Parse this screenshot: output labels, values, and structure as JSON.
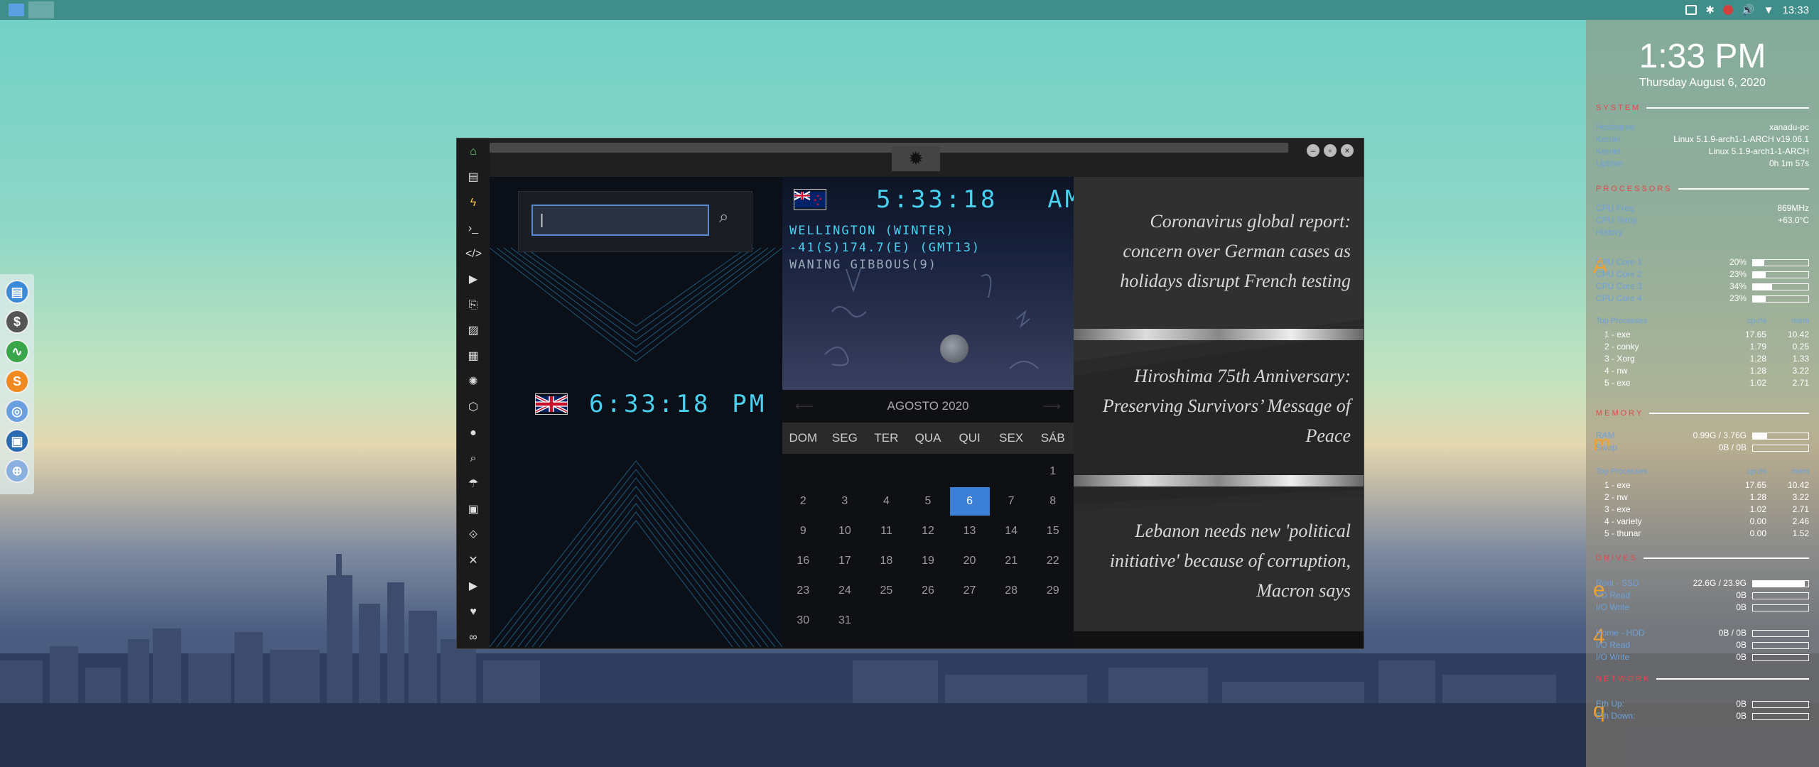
{
  "topbar": {
    "time": "13:33"
  },
  "window": {
    "search": {
      "value": "|"
    },
    "uk_clock": {
      "time": "6:33:18",
      "ampm": "PM"
    },
    "nz_clock": {
      "time": "5:33:18",
      "ampm": "AM"
    },
    "nz_info": {
      "line1": "WELLINGTON (WINTER)",
      "line2": "-41(S)174.7(E) (GMT13)",
      "line3": "WANING GIBBOUS(9)"
    },
    "calendar": {
      "month": "AGOSTO 2020",
      "dows": [
        "DOM",
        "SEG",
        "TER",
        "QUA",
        "QUI",
        "SEX",
        "SÁB"
      ],
      "days": [
        "",
        "",
        "",
        "",
        "",
        "",
        "1",
        "2",
        "3",
        "4",
        "5",
        "6",
        "7",
        "8",
        "9",
        "10",
        "11",
        "12",
        "13",
        "14",
        "15",
        "16",
        "17",
        "18",
        "19",
        "20",
        "21",
        "22",
        "23",
        "24",
        "25",
        "26",
        "27",
        "28",
        "29",
        "30",
        "31",
        "",
        "",
        "",
        "",
        ""
      ],
      "today": "6"
    },
    "news": [
      "Coronavirus global report: concern over German cases as holidays disrupt French testing",
      "Hiroshima 75th Anniversary: Preserving Survivors’ Message of Peace",
      "Lebanon needs new 'political initiative' because of corruption, Macron says"
    ]
  },
  "conky": {
    "clock": "1:33 PM",
    "date": "Thursday August  6, 2020",
    "system": {
      "title": "SYSTEM",
      "rows": [
        {
          "k": "Hostname",
          "v": "xanadu-pc"
        },
        {
          "k": "Kernel",
          "v": "Linux 5.1.9-arch1-1-ARCH v19.06.1"
        },
        {
          "k": "Kernel",
          "v": "Linux 5.1.9-arch1-1-ARCH"
        },
        {
          "k": "Uptime",
          "v": "0h 1m 57s"
        }
      ]
    },
    "processors": {
      "title": "PROCESSORS",
      "rows": [
        {
          "k": "CPU Freq",
          "v": "869MHz"
        },
        {
          "k": "CPU Temp",
          "v": "+63.0°C"
        },
        {
          "k": "History",
          "v": ""
        }
      ],
      "letter": "A",
      "cores": [
        {
          "k": "CPU Core 1",
          "v": "20%",
          "p": 0.2
        },
        {
          "k": "CPU Core 2",
          "v": "23%",
          "p": 0.23
        },
        {
          "k": "CPU Core 3",
          "v": "34%",
          "p": 0.34
        },
        {
          "k": "CPU Core 4",
          "v": "23%",
          "p": 0.23
        }
      ],
      "top_header": {
        "n": "Top Processes",
        "c1": "cpu%",
        "c2": "mem"
      },
      "top": [
        {
          "n": "1  -  exe",
          "c1": "17.65",
          "c2": "10.42"
        },
        {
          "n": "2  -  conky",
          "c1": "1.79",
          "c2": "0.25"
        },
        {
          "n": "3  -  Xorg",
          "c1": "1.28",
          "c2": "1.33"
        },
        {
          "n": "4  -  nw",
          "c1": "1.28",
          "c2": "3.22"
        },
        {
          "n": "5  -  exe",
          "c1": "1.02",
          "c2": "2.71"
        }
      ]
    },
    "memory": {
      "title": "MEMORY",
      "letter": "m",
      "rows": [
        {
          "k": "RAM",
          "v": "0.99G / 3.76G",
          "p": 0.26
        },
        {
          "k": "Swap",
          "v": "0B / 0B",
          "p": 0
        }
      ],
      "top_header": {
        "n": "Top Processes",
        "c1": "cpu%",
        "c2": "mem"
      },
      "top": [
        {
          "n": "1  -  exe",
          "c1": "17.65",
          "c2": "10.42"
        },
        {
          "n": "2  -  nw",
          "c1": "1.28",
          "c2": "3.22"
        },
        {
          "n": "3  -  exe",
          "c1": "1.02",
          "c2": "2.71"
        },
        {
          "n": "4  -  variety",
          "c1": "0.00",
          "c2": "2.46"
        },
        {
          "n": "5  -  thunar",
          "c1": "0.00",
          "c2": "1.52"
        }
      ]
    },
    "drives": {
      "title": "DRIVES",
      "letter1": "e",
      "rows1": [
        {
          "k": "Root - SSD",
          "v": "22.6G / 23.9G",
          "p": 0.94
        },
        {
          "k": "I/O Read",
          "v": "0B",
          "p": 0
        },
        {
          "k": "I/O Write",
          "v": "0B",
          "p": 0
        }
      ],
      "letter2": "4",
      "rows2": [
        {
          "k": "Home - HDD",
          "v": "0B / 0B",
          "p": 0
        },
        {
          "k": "I/O Read",
          "v": "0B",
          "p": 0
        },
        {
          "k": "I/O Write",
          "v": "0B",
          "p": 0
        }
      ]
    },
    "network": {
      "title": "NETWORK",
      "letter": "q",
      "rows": [
        {
          "k": "Eth Up:",
          "v": "0B",
          "p": 0
        },
        {
          "k": "Eth Down:",
          "v": "0B",
          "p": 0
        }
      ]
    }
  },
  "colors": {
    "accent": "#49d1f0",
    "today": "#3b7fd6",
    "conky_title": "#e04a4a"
  }
}
